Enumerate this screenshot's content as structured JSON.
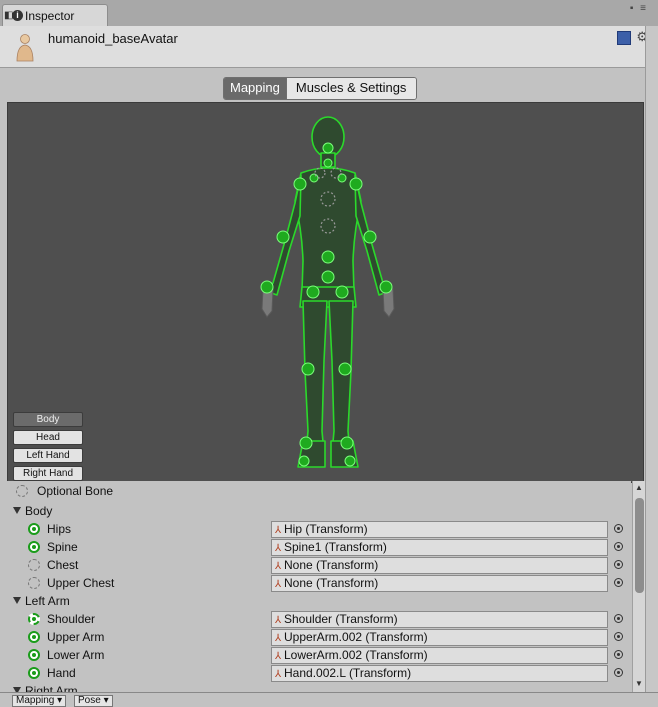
{
  "window": {
    "tab_title": "Inspector",
    "tab_controls": "▪ ≡"
  },
  "header": {
    "title": "humanoid_baseAvatar",
    "gear": "⚙"
  },
  "mode_tabs": [
    {
      "label": "Mapping",
      "active": true
    },
    {
      "label": "Muscles & Settings",
      "active": false
    }
  ],
  "body_panels": [
    {
      "label": "Body",
      "active": true
    },
    {
      "label": "Head",
      "active": false
    },
    {
      "label": "Left Hand",
      "active": false
    },
    {
      "label": "Right Hand",
      "active": false
    }
  ],
  "legend": {
    "optional_bone": "Optional Bone"
  },
  "groups": [
    {
      "name": "Body",
      "bones": [
        {
          "name": "Hips",
          "value": "Hip (Transform)",
          "status": "required"
        },
        {
          "name": "Spine",
          "value": "Spine1 (Transform)",
          "status": "required"
        },
        {
          "name": "Chest",
          "value": "None (Transform)",
          "status": "optional-empty"
        },
        {
          "name": "Upper Chest",
          "value": "None (Transform)",
          "status": "optional-empty"
        }
      ]
    },
    {
      "name": "Left Arm",
      "bones": [
        {
          "name": "Shoulder",
          "value": "Shoulder (Transform)",
          "status": "optional-mapped"
        },
        {
          "name": "Upper Arm",
          "value": "UpperArm.002 (Transform)",
          "status": "required"
        },
        {
          "name": "Lower Arm",
          "value": "LowerArm.002 (Transform)",
          "status": "required"
        },
        {
          "name": "Hand",
          "value": "Hand.002.L (Transform)",
          "status": "required"
        }
      ]
    },
    {
      "name": "Right Arm",
      "bones": []
    }
  ],
  "bottom_bar": [
    "Mapping ▾",
    "Pose ▾"
  ],
  "colors": {
    "bone_green": "#1a9c1a",
    "viewport_bg": "#4f4f4f",
    "figure_fill": "#2f4a2f",
    "figure_outline": "#2bd92b"
  }
}
